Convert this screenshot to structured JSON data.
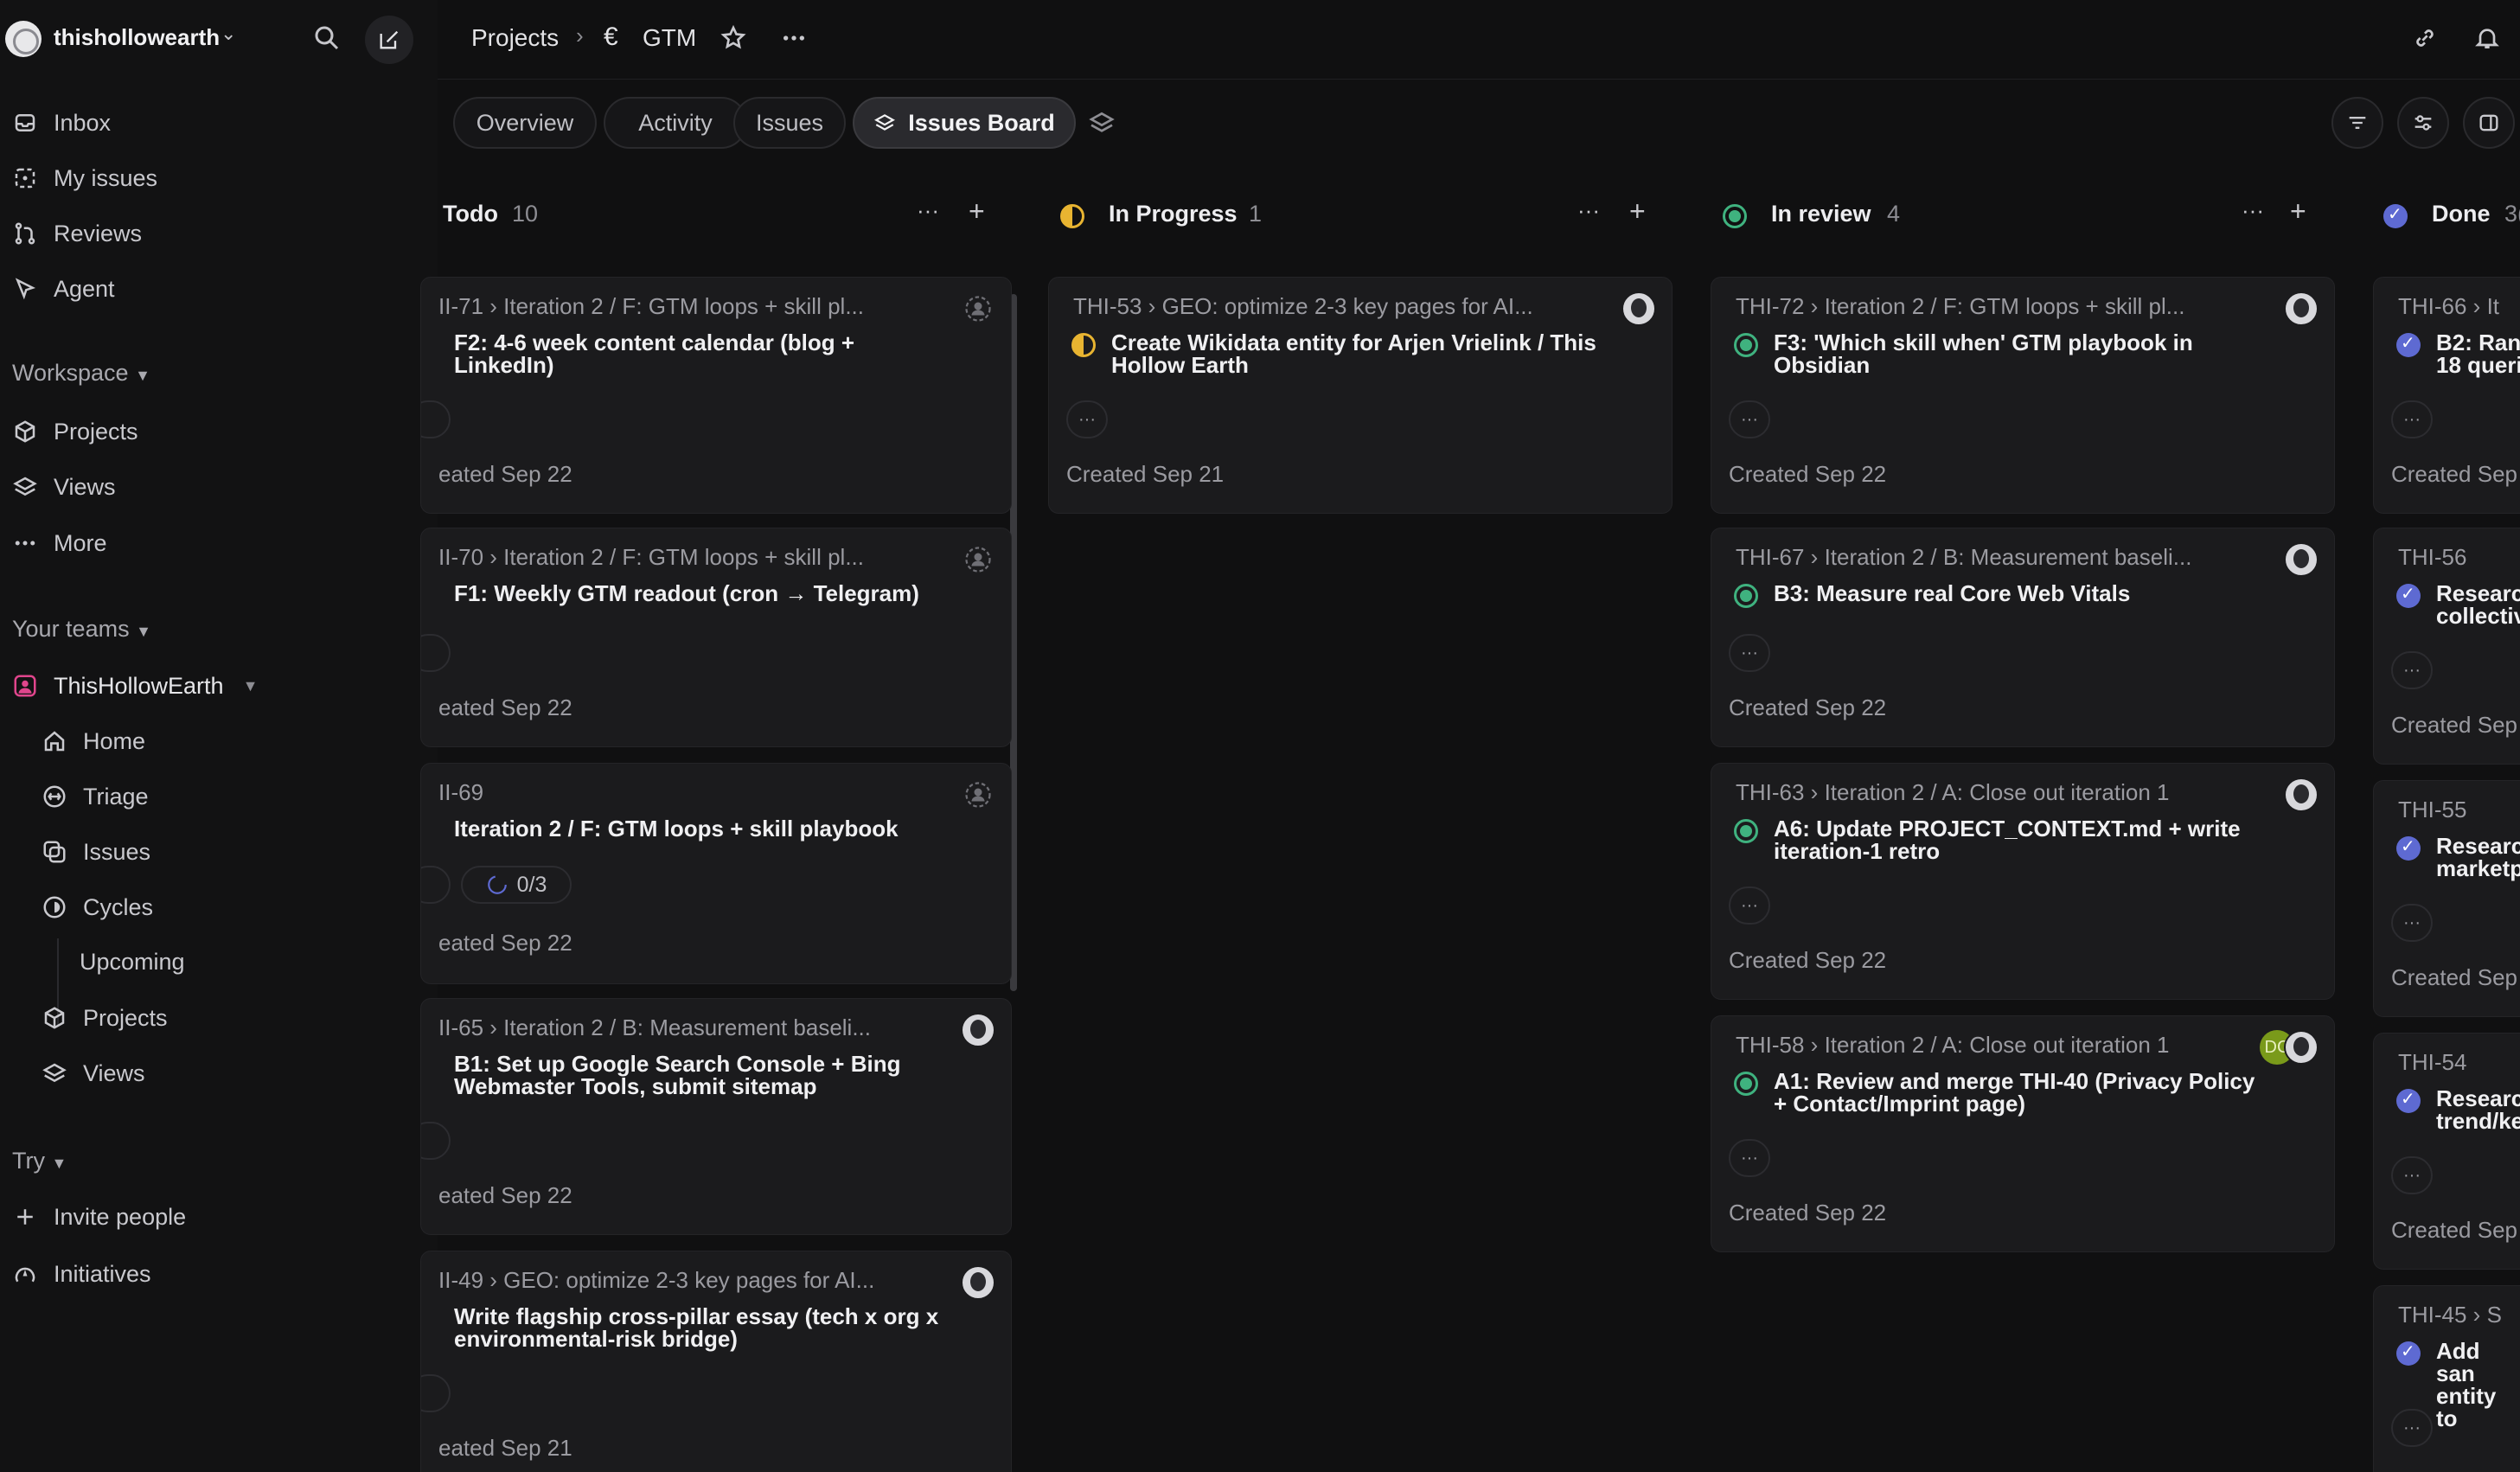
{
  "workspace": {
    "name": "thishollowearth"
  },
  "sidebar": {
    "primary": [
      {
        "label": "Inbox",
        "icon": "inbox-icon"
      },
      {
        "label": "My issues",
        "icon": "my-issues-icon"
      },
      {
        "label": "Reviews",
        "icon": "reviews-icon"
      },
      {
        "label": "Agent",
        "icon": "agent-icon"
      }
    ],
    "workspace_header": "Workspace",
    "workspace_items": [
      {
        "label": "Projects",
        "icon": "projects-icon"
      },
      {
        "label": "Views",
        "icon": "views-icon"
      },
      {
        "label": "More",
        "icon": "more-icon"
      }
    ],
    "teams_header": "Your teams",
    "team_name": "ThisHollowEarth",
    "team_items": [
      {
        "label": "Home",
        "icon": "home-icon"
      },
      {
        "label": "Triage",
        "icon": "triage-icon"
      },
      {
        "label": "Issues",
        "icon": "issues-icon"
      },
      {
        "label": "Cycles",
        "icon": "cycles-icon"
      },
      {
        "label": "Projects",
        "icon": "projects-icon"
      },
      {
        "label": "Views",
        "icon": "views-icon"
      }
    ],
    "cycles_sub": "Upcoming",
    "try_header": "Try",
    "try_items": [
      {
        "label": "Invite people",
        "icon": "plus-icon"
      },
      {
        "label": "Initiatives",
        "icon": "initiatives-icon"
      }
    ]
  },
  "header": {
    "crumb_root": "Projects",
    "crumb_symbol": "€",
    "crumb_project": "GTM"
  },
  "tabs": [
    "Overview",
    "Activity",
    "Issues",
    "Issues Board"
  ],
  "columns": [
    {
      "title": "Todo",
      "count": "10",
      "cards": [
        {
          "id": "II-71 › Iteration 2 / F: GTM loops + skill pl...",
          "title": "F2: 4-6 week content calendar (blog + LinkedIn)",
          "created": "eated Sep 22"
        },
        {
          "id": "II-70 › Iteration 2 / F: GTM loops + skill pl...",
          "title": "F1: Weekly GTM readout (cron → Telegram)",
          "created": "eated Sep 22"
        },
        {
          "id": "II-69",
          "title": "Iteration 2 / F: GTM loops + skill playbook",
          "progress": "0/3",
          "created": "eated Sep 22"
        },
        {
          "id": "II-65 › Iteration 2 / B: Measurement baseli...",
          "title": "B1: Set up Google Search Console + Bing Webmaster Tools, submit sitemap",
          "created": "eated Sep 22"
        },
        {
          "id": "II-49 › GEO: optimize 2-3 key pages for AI...",
          "title": "Write flagship cross-pillar essay (tech x org x environmental-risk bridge)",
          "created": "eated Sep 21"
        }
      ]
    },
    {
      "title": "In Progress",
      "count": "1",
      "cards": [
        {
          "id": "THI-53 › GEO: optimize 2-3 key pages for AI...",
          "title": "Create Wikidata entity for Arjen Vrielink / This Hollow Earth",
          "created": "Created Sep 21"
        }
      ]
    },
    {
      "title": "In review",
      "count": "4",
      "cards": [
        {
          "id": "THI-72 › Iteration 2 / F: GTM loops + skill pl...",
          "title": "F3: 'Which skill when' GTM playbook in Obsidian",
          "created": "Created Sep 22"
        },
        {
          "id": "THI-67 › Iteration 2 / B: Measurement baseli...",
          "title": "B3: Measure real Core Web Vitals",
          "created": "Created Sep 22"
        },
        {
          "id": "THI-63 › Iteration 2 / A: Close out iteration 1",
          "title": "A6: Update PROJECT_CONTEXT.md + write iteration-1 retro",
          "created": "Created Sep 22"
        },
        {
          "id": "THI-58 › Iteration 2 / A: Close out iteration 1",
          "title": "A1: Review and merge THI-40 (Privacy Policy + Contact/Imprint page)",
          "created": "Created Sep 22",
          "extra_avatar": "DC"
        }
      ]
    },
    {
      "title": "Done",
      "count": "3(",
      "cards": [
        {
          "id": "THI-66 › It",
          "title": "B2: Ran 18 queri",
          "created": "Created Sep"
        },
        {
          "id": "THI-56",
          "title": "Researc collectiv",
          "created": "Created Sep"
        },
        {
          "id": "THI-55",
          "title": "Researc marketp",
          "created": "Created Sep"
        },
        {
          "id": "THI-54",
          "title": "Researc trend/ke",
          "created": "Created Sep"
        },
        {
          "id": "THI-45 › S",
          "title": "Add san entity to",
          "created": ""
        }
      ]
    }
  ],
  "colors": {
    "accent": "#5e6ad2",
    "in_progress": "#e8b431",
    "in_review": "#3fb27f",
    "team": "#e0458c"
  }
}
